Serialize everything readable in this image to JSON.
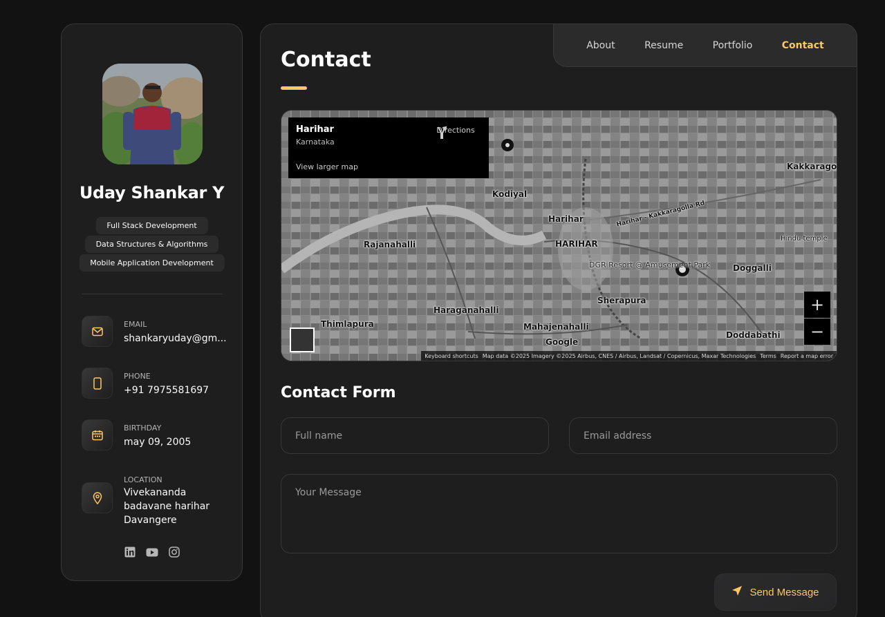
{
  "sidebar": {
    "name": "Uday Shankar Y",
    "tags": [
      "Full Stack Development",
      "Data Structures & Algorithms",
      "Mobile Application Development"
    ],
    "contacts": [
      {
        "icon": "mail-icon",
        "label": "EMAIL",
        "value": "shankaryuday@gm..."
      },
      {
        "icon": "phone-icon",
        "label": "PHONE",
        "value": "+91 7975581697"
      },
      {
        "icon": "calendar-icon",
        "label": "BIRTHDAY",
        "value": "may 09, 2005"
      },
      {
        "icon": "location-icon",
        "label": "LOCATION",
        "value_lines": [
          "Vivekananda",
          "badavane harihar",
          "Davangere"
        ]
      }
    ],
    "socials": [
      "linkedin-icon",
      "youtube-icon",
      "instagram-icon"
    ]
  },
  "nav": {
    "items": [
      "About",
      "Resume",
      "Portfolio",
      "Contact"
    ],
    "active": "Contact"
  },
  "page": {
    "title": "Contact"
  },
  "map": {
    "place_title": "Harihar",
    "place_sub": "Karnataka",
    "view_larger": "View larger map",
    "directions": "Directions",
    "labels": [
      "Kodiyal",
      "Harihar",
      "HARIHAR",
      "Rajanahalli",
      "Haraganahalli",
      "Thimlapura",
      "Mahajenahalli",
      "Sherapura",
      "Doggalli",
      "Doddabathi",
      "Kakkaragoll",
      "DGR Resort @ Amusement Park",
      "Harihar - Kakkaragolla Rd",
      "Hindu temple",
      "Google"
    ],
    "attribution": [
      "Keyboard shortcuts",
      "Map data ©2025 Imagery ©2025 Airbus, CNES / Airbus, Landsat / Copernicus, Maxar Technologies",
      "Terms",
      "Report a map error"
    ],
    "zoom_in": "+",
    "zoom_out": "−"
  },
  "form": {
    "title": "Contact Form",
    "fullname_placeholder": "Full name",
    "email_placeholder": "Email address",
    "message_placeholder": "Your Message",
    "send_label": "Send Message"
  },
  "colors": {
    "accent": "#ffc766",
    "bg": "#121212",
    "card": "#1e1e1f",
    "border": "#383838"
  }
}
